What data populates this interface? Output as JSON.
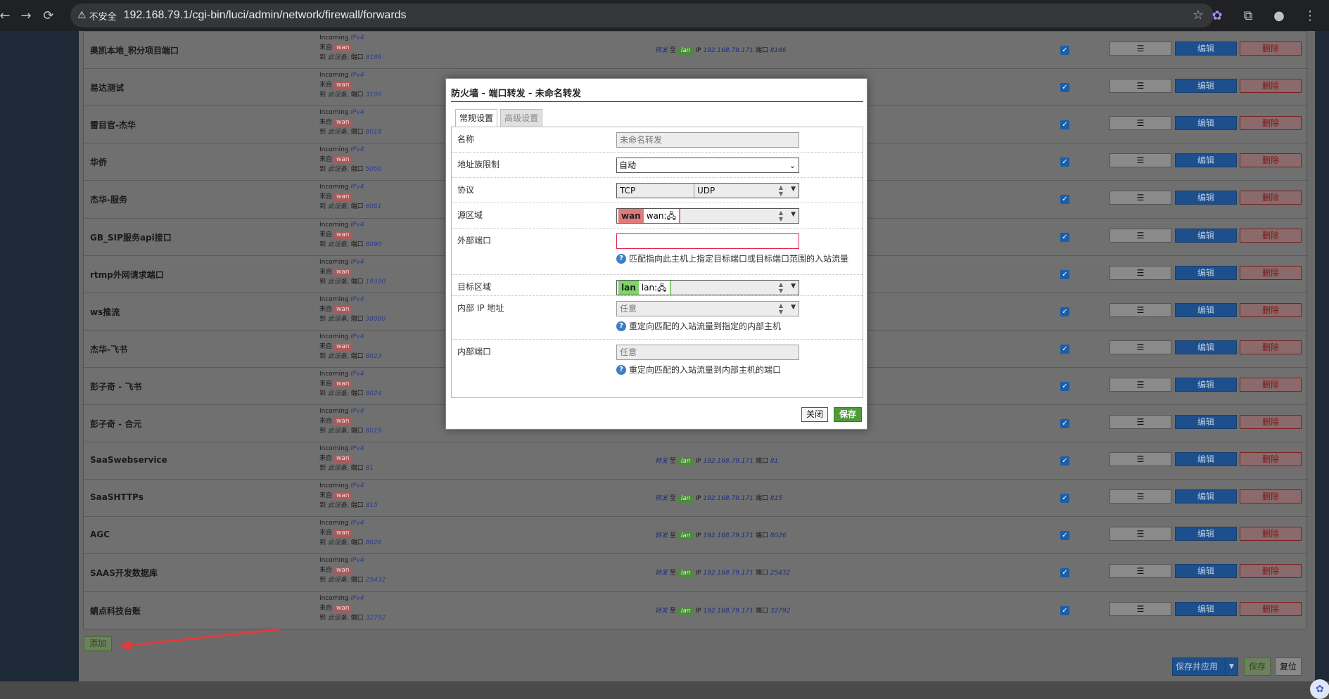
{
  "browser": {
    "insecure_label": "不安全",
    "url": "192.168.79.1/cgi-bin/luci/admin/network/firewall/forwards"
  },
  "rule_labels": {
    "incoming": "Incoming",
    "ipv4": "IPv4",
    "from": "来自",
    "to": "到",
    "this_device": "此设备",
    "port_prefix": "端口",
    "forward": "转发",
    "to_zone": "至",
    "ip": "IP",
    "port": "端口",
    "sort_glyph": "☰",
    "edit": "编辑",
    "delete": "删除",
    "wan": "wan",
    "lan": "lan"
  },
  "rules": [
    {
      "name": "奥凯本地_积分项目端口",
      "port": "8186",
      "target_ip": "192.168.79.171",
      "target_port": "8186",
      "action_visible": true
    },
    {
      "name": "易达测试",
      "port": "3100",
      "target_ip": "",
      "target_port": "",
      "action_visible": false
    },
    {
      "name": "雷目官-杰华",
      "port": "8018",
      "target_ip": "",
      "target_port": "",
      "action_visible": false
    },
    {
      "name": "华侨",
      "port": "5050",
      "target_ip": "",
      "target_port": "",
      "action_visible": false
    },
    {
      "name": "杰华-服务",
      "port": "6001",
      "target_ip": "",
      "target_port": "",
      "action_visible": false
    },
    {
      "name": "GB_SIP服务api接口",
      "port": "8090",
      "target_ip": "",
      "target_port": "",
      "action_visible": false
    },
    {
      "name": "rtmp外网请求端口",
      "port": "19350",
      "target_ip": "",
      "target_port": "",
      "action_visible": false
    },
    {
      "name": "ws推流",
      "port": "38080",
      "target_ip": "",
      "target_port": "",
      "action_visible": false
    },
    {
      "name": "杰华-飞书",
      "port": "8023",
      "target_ip": "",
      "target_port": "",
      "action_visible": false
    },
    {
      "name": "彭子奇 - 飞书",
      "port": "8024",
      "target_ip": "",
      "target_port": "",
      "action_visible": false
    },
    {
      "name": "彭子奇 - 合元",
      "port": "8019",
      "target_ip": "",
      "target_port": "",
      "action_visible": false
    },
    {
      "name": "SaaSwebservice",
      "port": "81",
      "target_ip": "192.168.79.171",
      "target_port": "81",
      "action_visible": true
    },
    {
      "name": "SaaSHTTPs",
      "port": "815",
      "target_ip": "192.168.79.171",
      "target_port": "815",
      "action_visible": true
    },
    {
      "name": "AGC",
      "port": "8026",
      "target_ip": "192.168.79.171",
      "target_port": "8026",
      "action_visible": true
    },
    {
      "name": "SAAS开发数据库",
      "port": "25432",
      "target_ip": "192.168.79.171",
      "target_port": "25432",
      "action_visible": true
    },
    {
      "name": "蜻点科技台账",
      "port": "32792",
      "target_ip": "192.168.79.171",
      "target_port": "32792",
      "action_visible": true
    }
  ],
  "footer": {
    "add_label": "添加",
    "save_apply_label": "保存并应用",
    "save_label": "保存",
    "reset_label": "复位"
  },
  "modal": {
    "title": "防火墙 - 端口转发 - 未命名转发",
    "tab_general": "常规设置",
    "tab_advanced": "高级设置",
    "name_label": "名称",
    "name_placeholder": "未命名转发",
    "family_label": "地址族限制",
    "family_value": "自动",
    "protocol_label": "协议",
    "protocol_values": [
      "TCP",
      "UDP"
    ],
    "src_zone_label": "源区域",
    "src_zone_badge": "wan",
    "src_zone_text": "wan:",
    "ext_port_label": "外部端口",
    "ext_port_value": "",
    "ext_port_hint": "匹配指向此主机上指定目标端口或目标端口范围的入站流量",
    "dest_zone_label": "目标区域",
    "dest_zone_badge": "lan",
    "dest_zone_text": "lan:",
    "internal_ip_label": "内部 IP 地址",
    "internal_ip_value": "任意",
    "internal_ip_hint": "重定向匹配的入站流量到指定的内部主机",
    "internal_port_label": "内部端口",
    "internal_port_placeholder": "任意",
    "internal_port_hint": "重定向匹配的入站流量到内部主机的端口",
    "close_label": "关闭",
    "save_label": "保存"
  },
  "colors": {
    "wan_badge": "#e07a7a",
    "lan_badge": "#7fd46a",
    "edit_button": "#1d4f8c",
    "save_button": "#4f9a3a"
  }
}
